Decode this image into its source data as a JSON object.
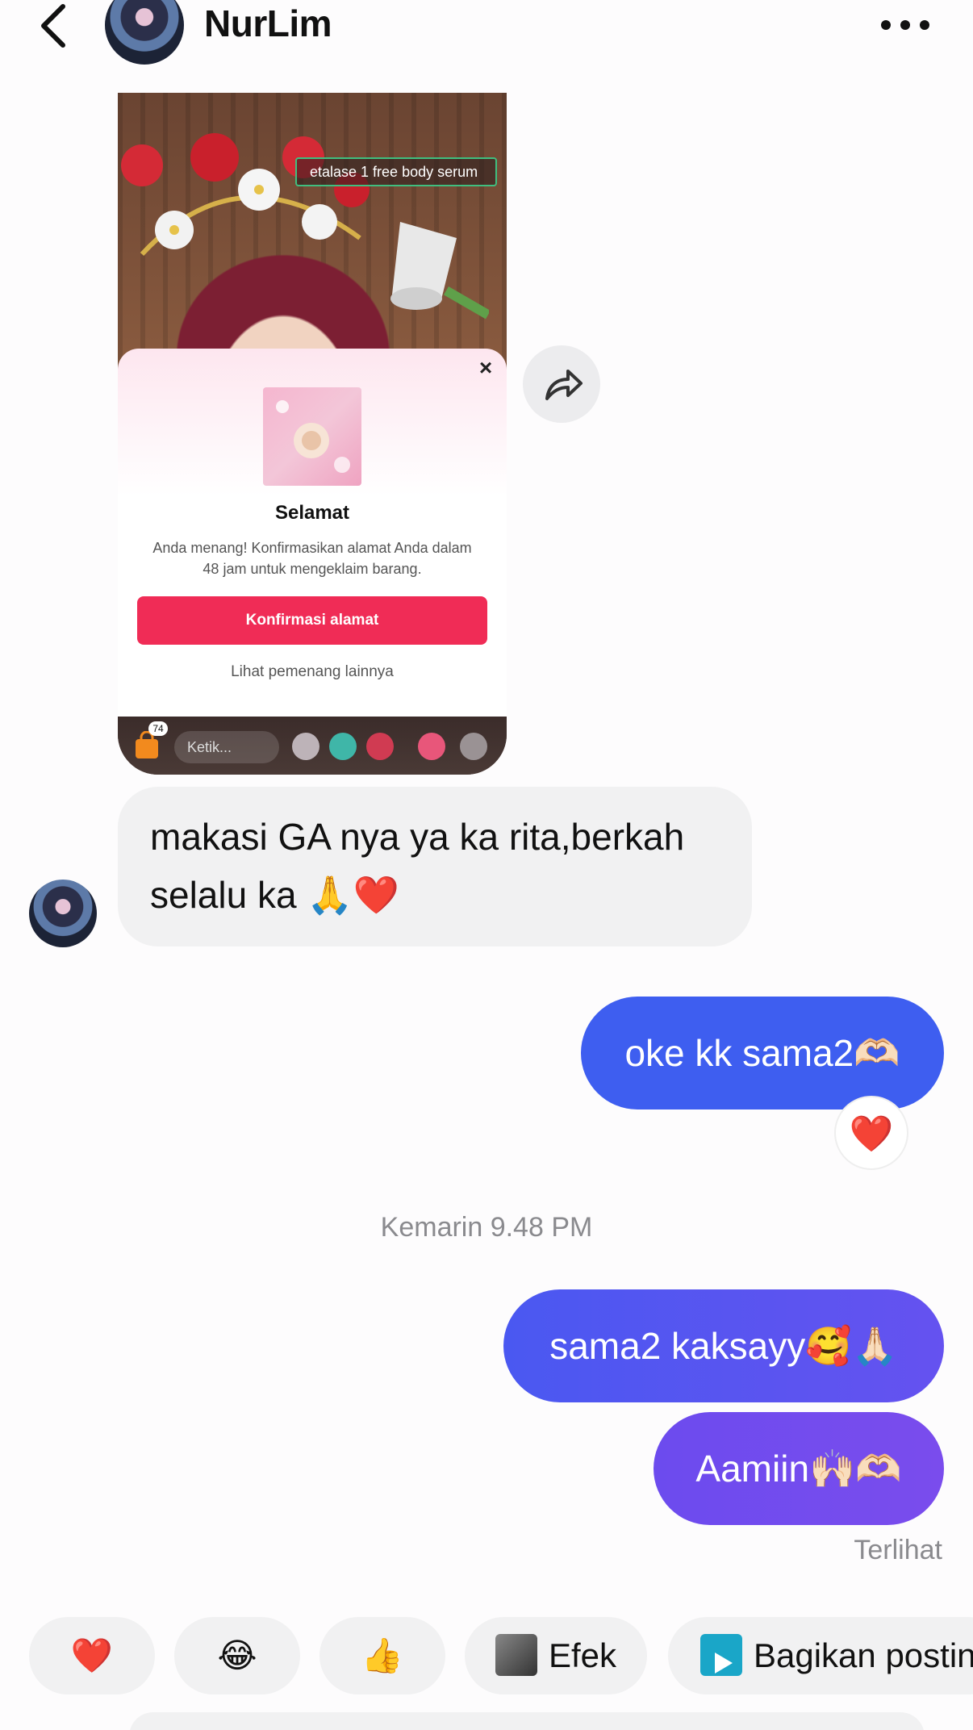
{
  "header": {
    "name": "NurLim",
    "back_icon": "chevron-left-icon",
    "more_icon": "more-horizontal-icon"
  },
  "shared_media": {
    "tag": "etalase 1 free body serum",
    "popup": {
      "title": "Selamat",
      "description": "Anda menang! Konfirmasikan alamat Anda dalam 48 jam untuk mengeklaim barang.",
      "button": "Konfirmasi alamat",
      "link": "Lihat pemenang lainnya",
      "close_icon": "close-icon"
    },
    "bottom": {
      "badge": "74",
      "input_placeholder": "Ketik..."
    }
  },
  "messages": {
    "incoming": "makasi GA nya ya ka rita,berkah selalu ka 🙏❤️",
    "out1": "oke kk sama2🫶🏻",
    "reaction": "❤️",
    "timestamp": "Kemarin 9.48 PM",
    "out2": "sama2 kaksayy🥰🙏🏻",
    "out3": "Aamiin🙌🏻🫶🏻",
    "status": "Terlihat"
  },
  "quick_replies": {
    "heart": "❤️",
    "laugh": "😂",
    "thumbs": "👍",
    "effect": "Efek",
    "share": "Bagikan postin"
  },
  "colors": {
    "bubble_out_start": "#3e5ef0",
    "bubble_out_end": "#7a4ced",
    "bubble_in": "#f1f1f2",
    "accent_button": "#f02c56"
  }
}
